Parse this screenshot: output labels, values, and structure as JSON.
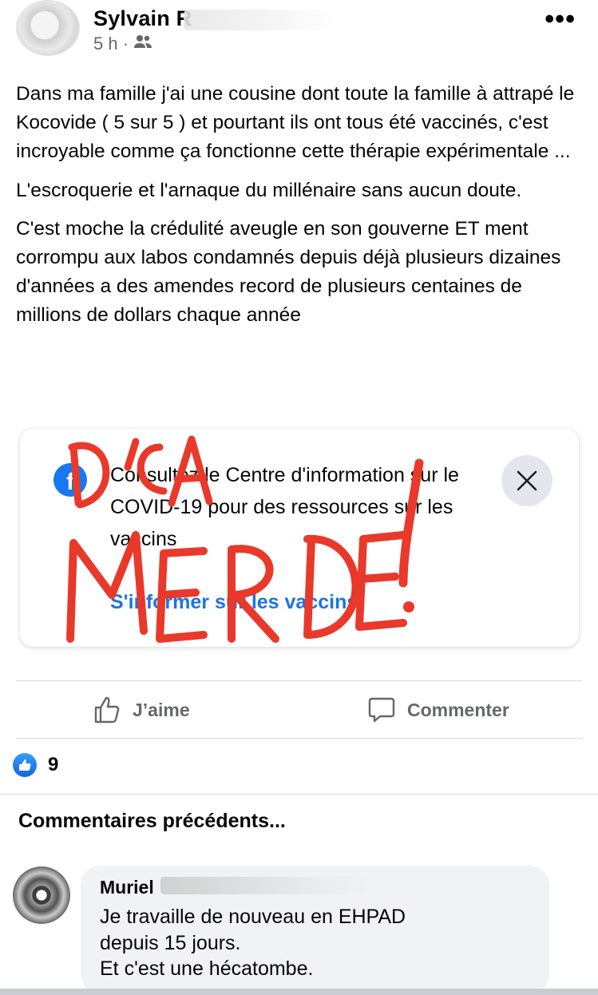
{
  "post": {
    "author_name": "Sylvain R",
    "time": "5 h ·",
    "paragraphs": [
      "Dans ma famille j'ai une cousine dont toute la famille à attrapé le Kocovide ( 5 sur 5 ) et pourtant ils ont tous été vaccinés, c'est incroyable comme ça fonctionne cette thérapie expérimentale ...",
      "L'escroquerie et l'arnaque du millénaire sans aucun doute.",
      "C'est moche la crédulité aveugle en son gouverne ET ment corrompu aux labos condamnés depuis déjà plusieurs dizaines d'années a des amendes record de plusieurs centaines de millions de dollars chaque année"
    ]
  },
  "info_card": {
    "text": "Consultez le Centre d'information sur le COVID-19 pour des ressources sur les vaccins",
    "link": "S'informer sur les vaccins",
    "overlay_lines": [
      "D'CA",
      "MERDE!"
    ],
    "overlay_color": "#e8392b"
  },
  "actions": {
    "like": "J’aime",
    "comment": "Commenter"
  },
  "reactions": {
    "count": "9"
  },
  "comments_section": {
    "previous_label": "Commentaires précédents...",
    "first_comment": {
      "author": "Muriel",
      "lines": [
        "Je travaille de nouveau en EHPAD",
        "depuis 15 jours.",
        "Et c'est une hécatombe."
      ]
    }
  },
  "colors": {
    "facebook_blue": "#1877f2",
    "link_blue": "#1b74e4",
    "secondary_text": "#65676b",
    "bubble_bg": "#f0f2f5"
  },
  "icons": [
    "more-icon",
    "friends-icon",
    "facebook-logo-icon",
    "close-icon",
    "like-thumb-icon",
    "comment-icon",
    "like-reaction-icon"
  ]
}
